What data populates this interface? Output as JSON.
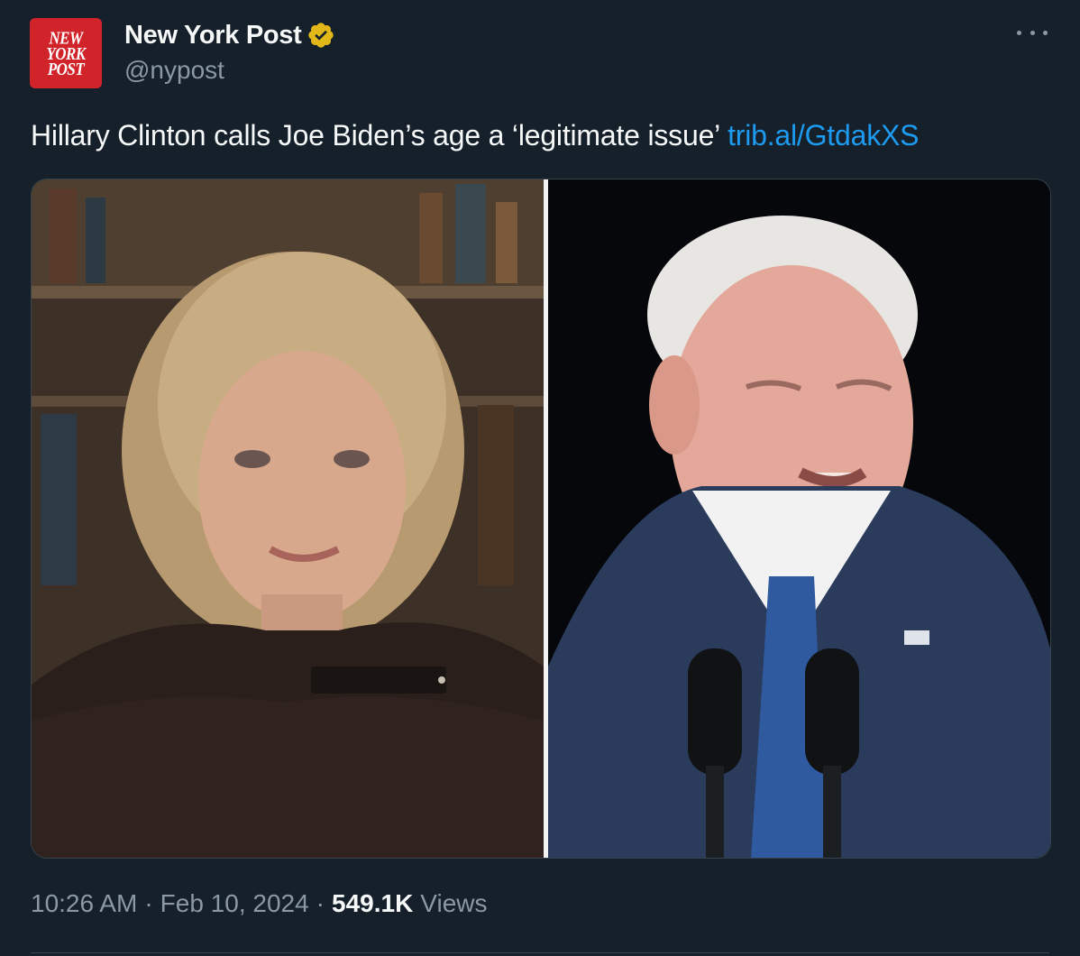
{
  "author": {
    "display_name": "New York Post",
    "handle": "@nypost",
    "avatar_text": [
      "NEW",
      "YORK",
      "POST"
    ],
    "verified": true,
    "verified_color": "#e2b719",
    "avatar_color": "#d1232a"
  },
  "tweet": {
    "text": "Hillary Clinton calls Joe Biden’s age a ‘legitimate issue’",
    "link_text": "trib.al/GtdakXS",
    "link_color": "#1d9bf0"
  },
  "media": {
    "left_photo": "photo of Hillary Clinton",
    "right_photo": "photo of Joe Biden at podium"
  },
  "meta": {
    "time": "10:26 AM",
    "separator": "·",
    "date": "Feb 10, 2024",
    "views_count": "549.1K",
    "views_label": "Views"
  },
  "icons": {
    "more": "more-options-icon",
    "verified": "verified-badge-icon"
  },
  "theme": {
    "background": "#15202b",
    "text": "#f7f9f9",
    "secondary_text": "#8b98a5",
    "border": "#38444d"
  }
}
